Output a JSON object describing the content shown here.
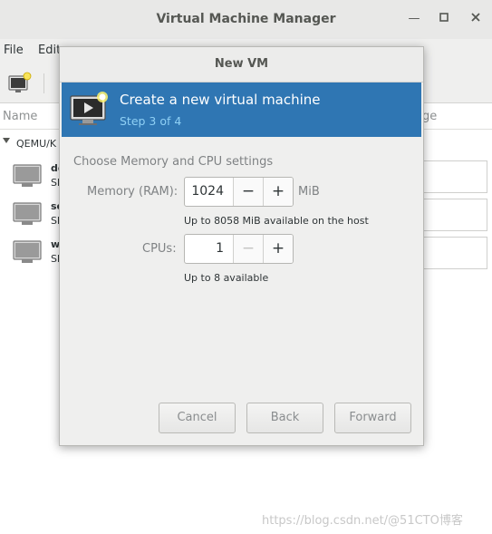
{
  "main_window": {
    "title": "Virtual Machine Manager",
    "controls": {
      "minimize_glyph": "—",
      "maximize_glyph": "□",
      "close_glyph": "✕"
    },
    "menu": [
      "File",
      "Edit"
    ],
    "columns": {
      "name": "Name",
      "usage": "ge"
    },
    "connection": "QEMU/K",
    "vms": [
      {
        "name": "de",
        "state": "Sh"
      },
      {
        "name": "se",
        "state": "Sh"
      },
      {
        "name": "w",
        "state": "Sh"
      }
    ]
  },
  "dialog": {
    "title": "New VM",
    "header": {
      "title": "Create a new virtual machine",
      "step": "Step 3 of 4",
      "icon": "new-vm-icon"
    },
    "section_title": "Choose Memory and CPU settings",
    "memory": {
      "label": "Memory (RAM):",
      "value": "1024",
      "unit": "MiB",
      "hint": "Up to 8058 MiB available on the host"
    },
    "cpus": {
      "label": "CPUs:",
      "value": "1",
      "hint": "Up to 8 available"
    },
    "buttons": {
      "cancel": "Cancel",
      "back": "Back",
      "forward": "Forward"
    },
    "spin_glyphs": {
      "minus": "−",
      "plus": "+"
    }
  },
  "watermark": "https://blog.csdn.net/@51CTO博客",
  "colors": {
    "header_blue": "#2f76b3",
    "step_text": "#8fd0f5"
  }
}
